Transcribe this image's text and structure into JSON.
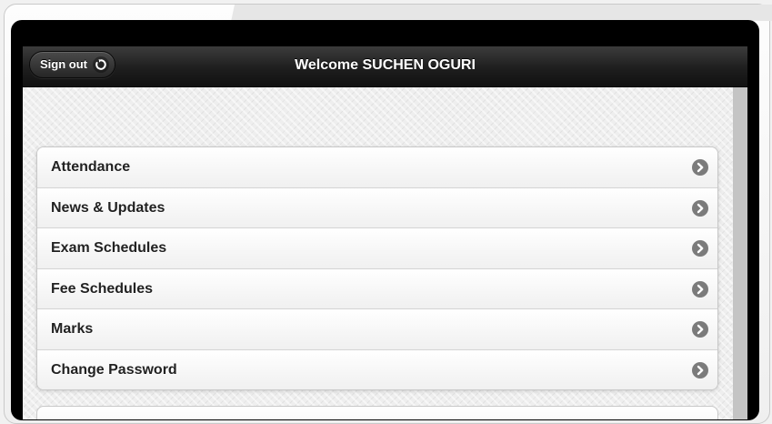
{
  "header": {
    "title": "Welcome SUCHEN OGURI",
    "signout_label": "Sign out",
    "signout_icon": "refresh-icon"
  },
  "menu": {
    "items": [
      {
        "label": "Attendance",
        "icon": "chevron-right-icon"
      },
      {
        "label": "News & Updates",
        "icon": "chevron-right-icon"
      },
      {
        "label": "Exam Schedules",
        "icon": "chevron-right-icon"
      },
      {
        "label": "Fee Schedules",
        "icon": "chevron-right-icon"
      },
      {
        "label": "Marks",
        "icon": "chevron-right-icon"
      },
      {
        "label": "Change Password",
        "icon": "chevron-right-icon"
      }
    ]
  },
  "colors": {
    "header_bg": "#1e1e1e",
    "item_text": "#222222",
    "arrow_bg": "#7b7b7b"
  }
}
